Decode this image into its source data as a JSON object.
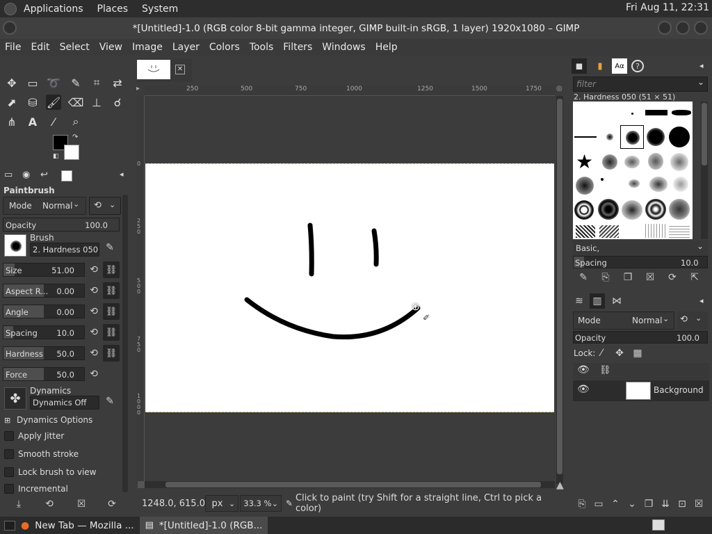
{
  "top_panel": {
    "menus": [
      "Applications",
      "Places",
      "System"
    ],
    "clock": "Fri Aug 11, 22:31"
  },
  "window": {
    "title": "*[Untitled]-1.0 (RGB color 8-bit gamma integer, GIMP built-in sRGB, 1 layer) 1920x1080 – GIMP"
  },
  "menubar": [
    "File",
    "Edit",
    "Select",
    "View",
    "Image",
    "Layer",
    "Colors",
    "Tools",
    "Filters",
    "Windows",
    "Help"
  ],
  "tool_options": {
    "title": "Paintbrush",
    "mode_label": "Mode",
    "mode_value": "Normal",
    "opacity": {
      "label": "Opacity",
      "value": "100.0"
    },
    "brush_label": "Brush",
    "brush_value": "2. Hardness 050",
    "size": {
      "label": "Size",
      "value": "51.00"
    },
    "aspect": {
      "label": "Aspect R...",
      "value": "0.00"
    },
    "angle": {
      "label": "Angle",
      "value": "0.00"
    },
    "spacing": {
      "label": "Spacing",
      "value": "10.0"
    },
    "hardness": {
      "label": "Hardness",
      "value": "50.0"
    },
    "force": {
      "label": "Force",
      "value": "50.0"
    },
    "dynamics_label": "Dynamics",
    "dynamics_value": "Dynamics Off",
    "dynamics_options": "Dynamics Options",
    "checkboxes": [
      "Apply Jitter",
      "Smooth stroke",
      "Lock brush to view",
      "Incremental"
    ]
  },
  "ruler": {
    "h_ticks": [
      "250",
      "500",
      "750",
      "1000",
      "1250",
      "1500",
      "1750"
    ],
    "v_ticks": [
      "0",
      "2 5 0",
      "5 0 0",
      "7 5 0",
      "1 0 0 0"
    ]
  },
  "status": {
    "coords": "1248.0, 615.0",
    "unit": "px",
    "zoom": "33.3 %",
    "message": "Click to paint (try Shift for a straight line, Ctrl to pick a color)"
  },
  "brushes_panel": {
    "filter_placeholder": "filter",
    "selected": "2. Hardness 050 (51 × 51)",
    "preset": "Basic,",
    "spacing": {
      "label": "Spacing",
      "value": "10.0"
    }
  },
  "layers_panel": {
    "mode_label": "Mode",
    "mode_value": "Normal",
    "opacity": {
      "label": "Opacity",
      "value": "100.0"
    },
    "lock_label": "Lock:",
    "layer_name": "Background"
  },
  "taskbar": {
    "items": [
      "New Tab — Mozilla ...",
      "*[Untitled]-1.0 (RGB..."
    ]
  },
  "icons": [
    "move-icon",
    "rect-select-icon",
    "lasso-icon",
    "fuzzy-select-icon",
    "crop-icon",
    "warp-icon",
    "fill-icon",
    "paintbrush-icon",
    "eraser-icon",
    "clone-icon",
    "smudge-icon",
    "path-icon",
    "text-icon",
    "color-picker-icon",
    "zoom-icon"
  ]
}
